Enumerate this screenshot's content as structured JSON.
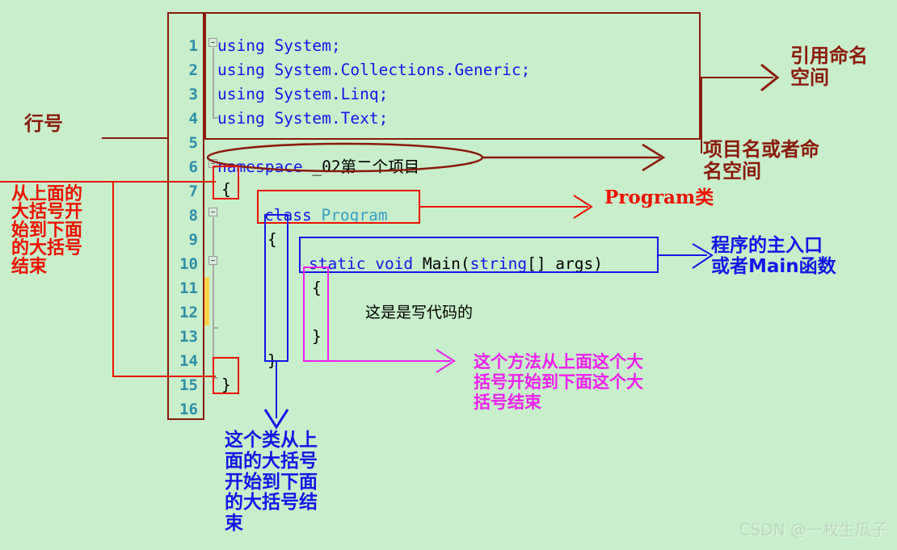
{
  "background_color": "#c8eecb",
  "editor": {
    "line_numbers": [
      "1",
      "2",
      "3",
      "4",
      "5",
      "6",
      "7",
      "8",
      "9",
      "10",
      "11",
      "12",
      "13",
      "14",
      "15",
      "16"
    ],
    "lines": [
      {
        "n": "1",
        "tokens": [
          {
            "t": "using",
            "c": "kw"
          },
          {
            "t": " System;",
            "c": "pl"
          }
        ]
      },
      {
        "n": "2",
        "tokens": [
          {
            "t": "using",
            "c": "kw"
          },
          {
            "t": " System.Collections.Generic;",
            "c": "pl"
          }
        ]
      },
      {
        "n": "3",
        "tokens": [
          {
            "t": "using",
            "c": "kw"
          },
          {
            "t": " System.Linq;",
            "c": "pl"
          }
        ]
      },
      {
        "n": "4",
        "tokens": [
          {
            "t": "using",
            "c": "kw"
          },
          {
            "t": " System.Text;",
            "c": "pl"
          }
        ]
      },
      {
        "n": "5",
        "tokens": []
      },
      {
        "n": "6",
        "tokens": [
          {
            "t": "namespace",
            "c": "kw"
          },
          {
            "t": " _02第二个项目",
            "c": "pl"
          }
        ]
      },
      {
        "n": "7",
        "tokens": [
          {
            "t": "{",
            "c": "pl"
          }
        ]
      },
      {
        "n": "8",
        "tokens": [
          {
            "t": "class",
            "c": "kw"
          },
          {
            "t": " ",
            "c": "pl"
          },
          {
            "t": "Program",
            "c": "ty"
          }
        ]
      },
      {
        "n": "9",
        "tokens": [
          {
            "t": "{",
            "c": "pl"
          }
        ]
      },
      {
        "n": "10",
        "tokens": [
          {
            "t": "static",
            "c": "kw"
          },
          {
            "t": " ",
            "c": "pl"
          },
          {
            "t": "void",
            "c": "kw"
          },
          {
            "t": " Main(",
            "c": "pl"
          },
          {
            "t": "string",
            "c": "kw"
          },
          {
            "t": "[] args)",
            "c": "pl"
          }
        ]
      },
      {
        "n": "11",
        "tokens": [
          {
            "t": "{",
            "c": "pl"
          }
        ]
      },
      {
        "n": "12",
        "tokens": [
          {
            "t": "这是是写代码的",
            "c": "cn"
          }
        ]
      },
      {
        "n": "13",
        "tokens": [
          {
            "t": "}",
            "c": "pl"
          }
        ]
      },
      {
        "n": "14",
        "tokens": [
          {
            "t": "}",
            "c": "pl"
          }
        ]
      },
      {
        "n": "15",
        "tokens": [
          {
            "t": "}",
            "c": "pl"
          }
        ]
      },
      {
        "n": "16",
        "tokens": []
      }
    ],
    "code_text": {
      "l1": "using System;",
      "l2": "using System.Collections.Generic;",
      "l3": "using System.Linq;",
      "l4": "using System.Text;",
      "l6_kw": "namespace",
      "l6_name": " _02第二个项目",
      "l7_brace": "{",
      "l8_kw": "class",
      "l8_name": "Program",
      "l9_brace": "{",
      "l10_a": "static",
      "l10_b": "void",
      "l10_c": " Main(",
      "l10_d": "string",
      "l10_e": "[] args)",
      "l11_brace": "{",
      "l12_comment": "这是是写代码的",
      "l13_brace": "}",
      "l14_brace": "}",
      "l15_brace": "}"
    }
  },
  "annotations": {
    "line_number_label": "行号",
    "namespace_block_label": "从上面的\n大括号开\n始到下面\n的大括号\n结束",
    "using_label": "引用命名\n空间",
    "namespace_label": "项目名或者命\n名空间",
    "class_label": "Program类",
    "main_label": "程序的主入口\n或者Main函数",
    "method_block_label": "这个方法从上面这个大\n括号开始到下面这个大\n括号结束",
    "class_block_label": "这个类从上\n面的大括号\n开始到下面\n的大括号结\n束"
  },
  "colors": {
    "dark_red": "#8b1a0e",
    "red": "#ee1100",
    "blue": "#1616e8",
    "magenta": "#ee22ee",
    "teal_lineno": "#2e8fa8",
    "type_teal": "#3a9ec4"
  },
  "watermark": "CSDN @一枚生瓜子"
}
